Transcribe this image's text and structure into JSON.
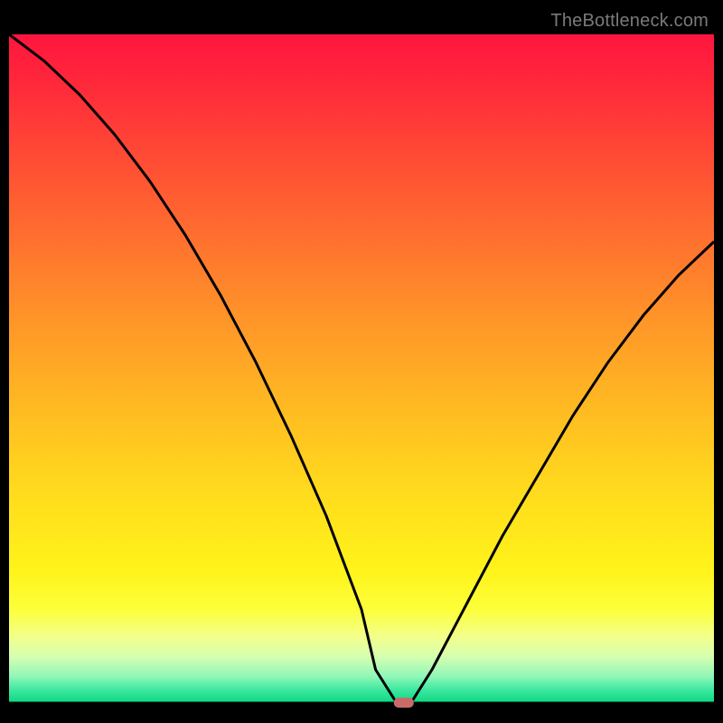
{
  "attribution": "TheBottleneck.com",
  "chart_data": {
    "type": "line",
    "title": "",
    "xlabel": "",
    "ylabel": "",
    "xlim": [
      0,
      100
    ],
    "ylim": [
      0,
      100
    ],
    "x": [
      0,
      5,
      10,
      15,
      20,
      25,
      30,
      35,
      40,
      45,
      50,
      52,
      55,
      57,
      60,
      65,
      70,
      75,
      80,
      85,
      90,
      95,
      100
    ],
    "values": [
      100,
      96,
      91,
      85,
      78,
      70,
      61,
      51,
      40,
      28,
      14,
      5,
      0,
      0,
      5,
      15,
      25,
      34,
      43,
      51,
      58,
      64,
      69
    ],
    "marker": {
      "x": 56,
      "y": 0,
      "color": "#c96a6a"
    },
    "background_gradient": {
      "stops": [
        {
          "offset": 0.0,
          "color": "#ff153f"
        },
        {
          "offset": 0.08,
          "color": "#ff2a3a"
        },
        {
          "offset": 0.18,
          "color": "#ff4a35"
        },
        {
          "offset": 0.3,
          "color": "#ff6e2f"
        },
        {
          "offset": 0.42,
          "color": "#ff9329"
        },
        {
          "offset": 0.55,
          "color": "#ffb822"
        },
        {
          "offset": 0.68,
          "color": "#ffda1d"
        },
        {
          "offset": 0.8,
          "color": "#fff31a"
        },
        {
          "offset": 0.86,
          "color": "#fcff3a"
        },
        {
          "offset": 0.9,
          "color": "#f4ff8a"
        },
        {
          "offset": 0.93,
          "color": "#d6ffb0"
        },
        {
          "offset": 0.96,
          "color": "#90f7b8"
        },
        {
          "offset": 0.98,
          "color": "#3ee8a0"
        },
        {
          "offset": 1.0,
          "color": "#09d77f"
        }
      ]
    }
  }
}
